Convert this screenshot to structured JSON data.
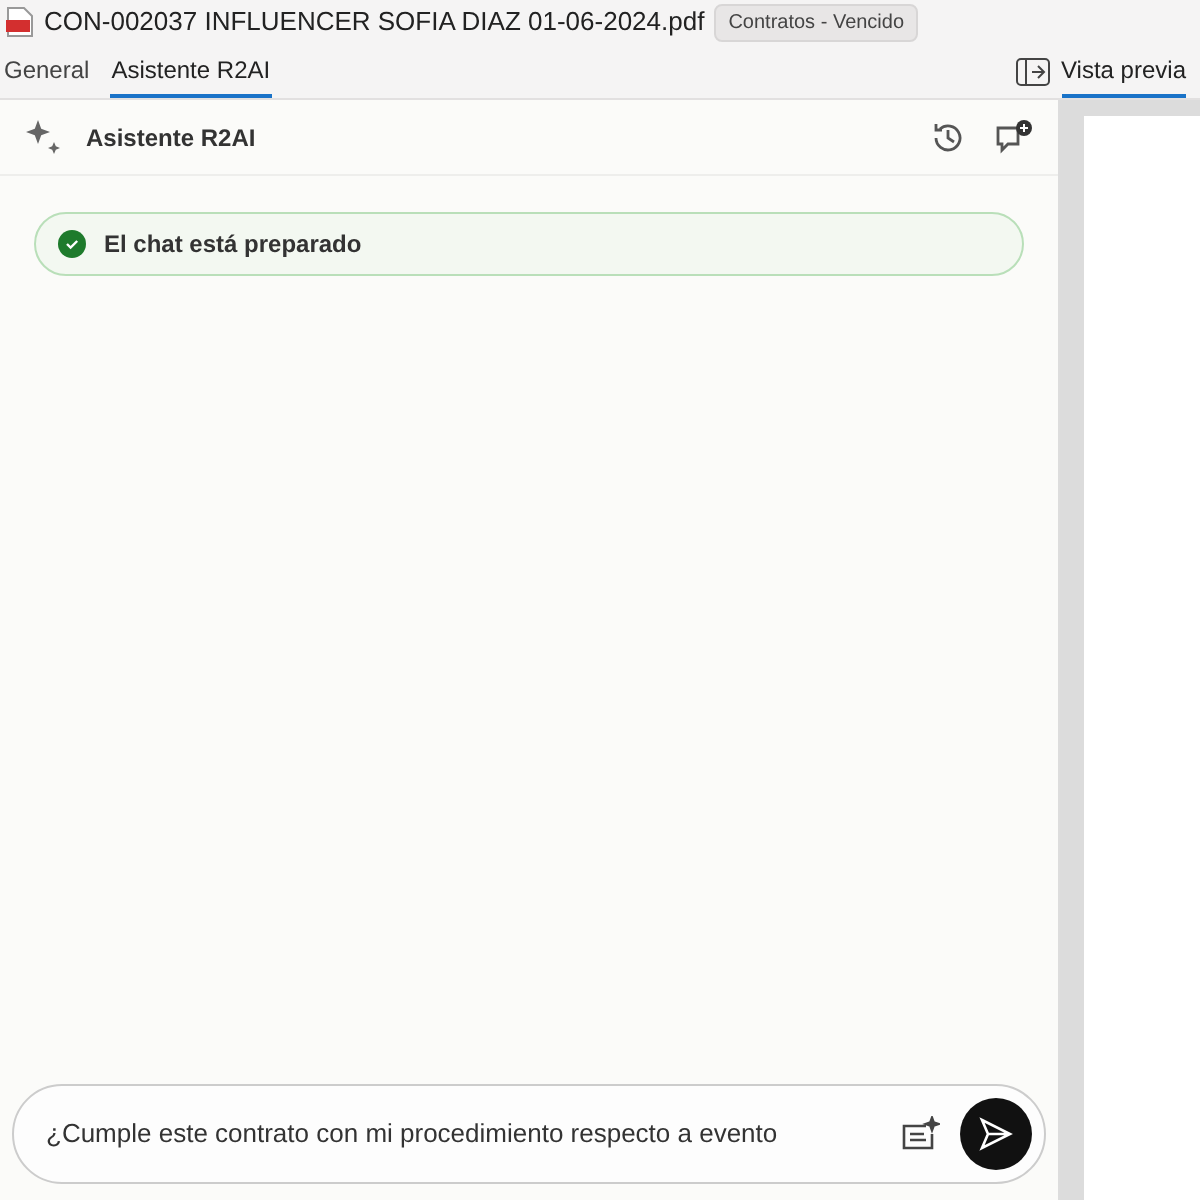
{
  "document": {
    "title": "CON-002037 INFLUENCER SOFIA DIAZ 01-06-2024.pdf",
    "badge": "Contratos - Vencido"
  },
  "tabs": [
    {
      "label": "General",
      "selected": false
    },
    {
      "label": "Asistente R2AI",
      "selected": true
    }
  ],
  "preview_toggle": {
    "label": "Vista previa",
    "selected": true
  },
  "assistant": {
    "title": "Asistente R2AI",
    "status": "El chat está preparado"
  },
  "composer": {
    "value": "¿Cumple este contrato con mi procedimiento respecto a evento"
  }
}
